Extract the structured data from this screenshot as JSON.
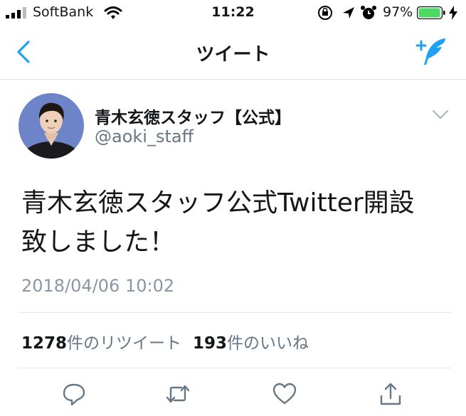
{
  "status_bar": {
    "carrier": "SoftBank",
    "time": "11:22",
    "battery_percent": "97%",
    "battery_level": 0.97
  },
  "nav": {
    "title": "ツイート",
    "back_icon": "chevron-left-icon",
    "compose_icon": "compose-tweet-icon"
  },
  "tweet": {
    "display_name": "青木玄徳スタッフ【公式】",
    "handle": "@aoki_staff",
    "text_line1": "青木玄徳スタッフ公式Twitter開設",
    "text_line2": "致しました！",
    "timestamp": "2018/04/06 10:02",
    "retweet_count": "1278",
    "retweet_label": "件のリツイート",
    "like_count": "193",
    "like_label": "件のいいね"
  },
  "actions": [
    "reply-icon",
    "retweet-icon",
    "like-icon",
    "share-icon"
  ],
  "colors": {
    "accent": "#1da1f2",
    "secondary_text": "#657786",
    "battery_green": "#4cd964",
    "icon_gray": "#657786"
  }
}
